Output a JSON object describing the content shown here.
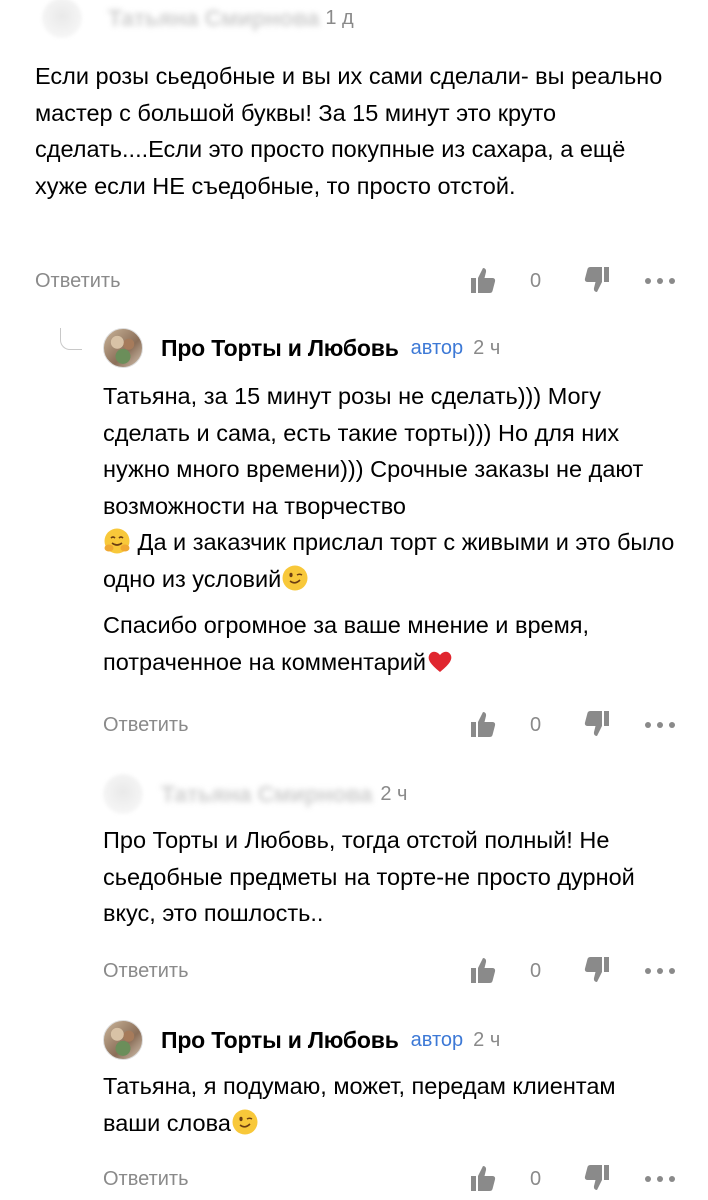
{
  "comments": [
    {
      "author": "Татьяна Смирнова",
      "author_tag": "",
      "time": "1 д",
      "paragraphs": [
        "Если розы сьедобные и вы их сами сделали- вы реально мастер с большой буквы! За 15 минут это круто сделать....Если это просто покупные из сахара, а ещё хуже если НЕ съедобные, то просто отстой."
      ],
      "reply_label": "Ответить",
      "likes": "0"
    },
    {
      "author": "Про Торты и Любовь",
      "author_tag": "автор",
      "time": "2 ч",
      "paragraphs": [
        "Татьяна, за 15 минут розы не сделать))) Могу сделать и сама, есть такие торты))) Но для них нужно много времени))) Срочные заказы не дают возможности на творчество",
        "Да и заказчик прислал торт с живыми и это было одно из условий",
        "Спасибо огромное за ваше мнение и время, потраченное на комментарий"
      ],
      "reply_label": "Ответить",
      "likes": "0"
    },
    {
      "author": "Татьяна Смирнова",
      "author_tag": "",
      "time": "2 ч",
      "paragraphs": [
        "Про Торты и Любовь, тогда отстой полный! Не сьедобные предметы на торте-не просто дурной вкус, это пошлость.."
      ],
      "reply_label": "Ответить",
      "likes": "0"
    },
    {
      "author": "Про Торты и Любовь",
      "author_tag": "автор",
      "time": "2 ч",
      "paragraphs": [
        "Татьяна, я подумаю, может, передам клиентам ваши слова"
      ],
      "reply_label": "Ответить",
      "likes": "0"
    }
  ],
  "icons": {
    "like": "thumbs-up-icon",
    "dislike": "thumbs-down-icon",
    "more": "more-dots-icon",
    "hug_emoji": "hugging-face-emoji",
    "wink_emoji": "winking-face-emoji",
    "heart_emoji": "red-heart-emoji"
  },
  "colors": {
    "author_tag": "#3d79d6",
    "muted": "#8a8a8a",
    "heart": "#e0262f"
  }
}
